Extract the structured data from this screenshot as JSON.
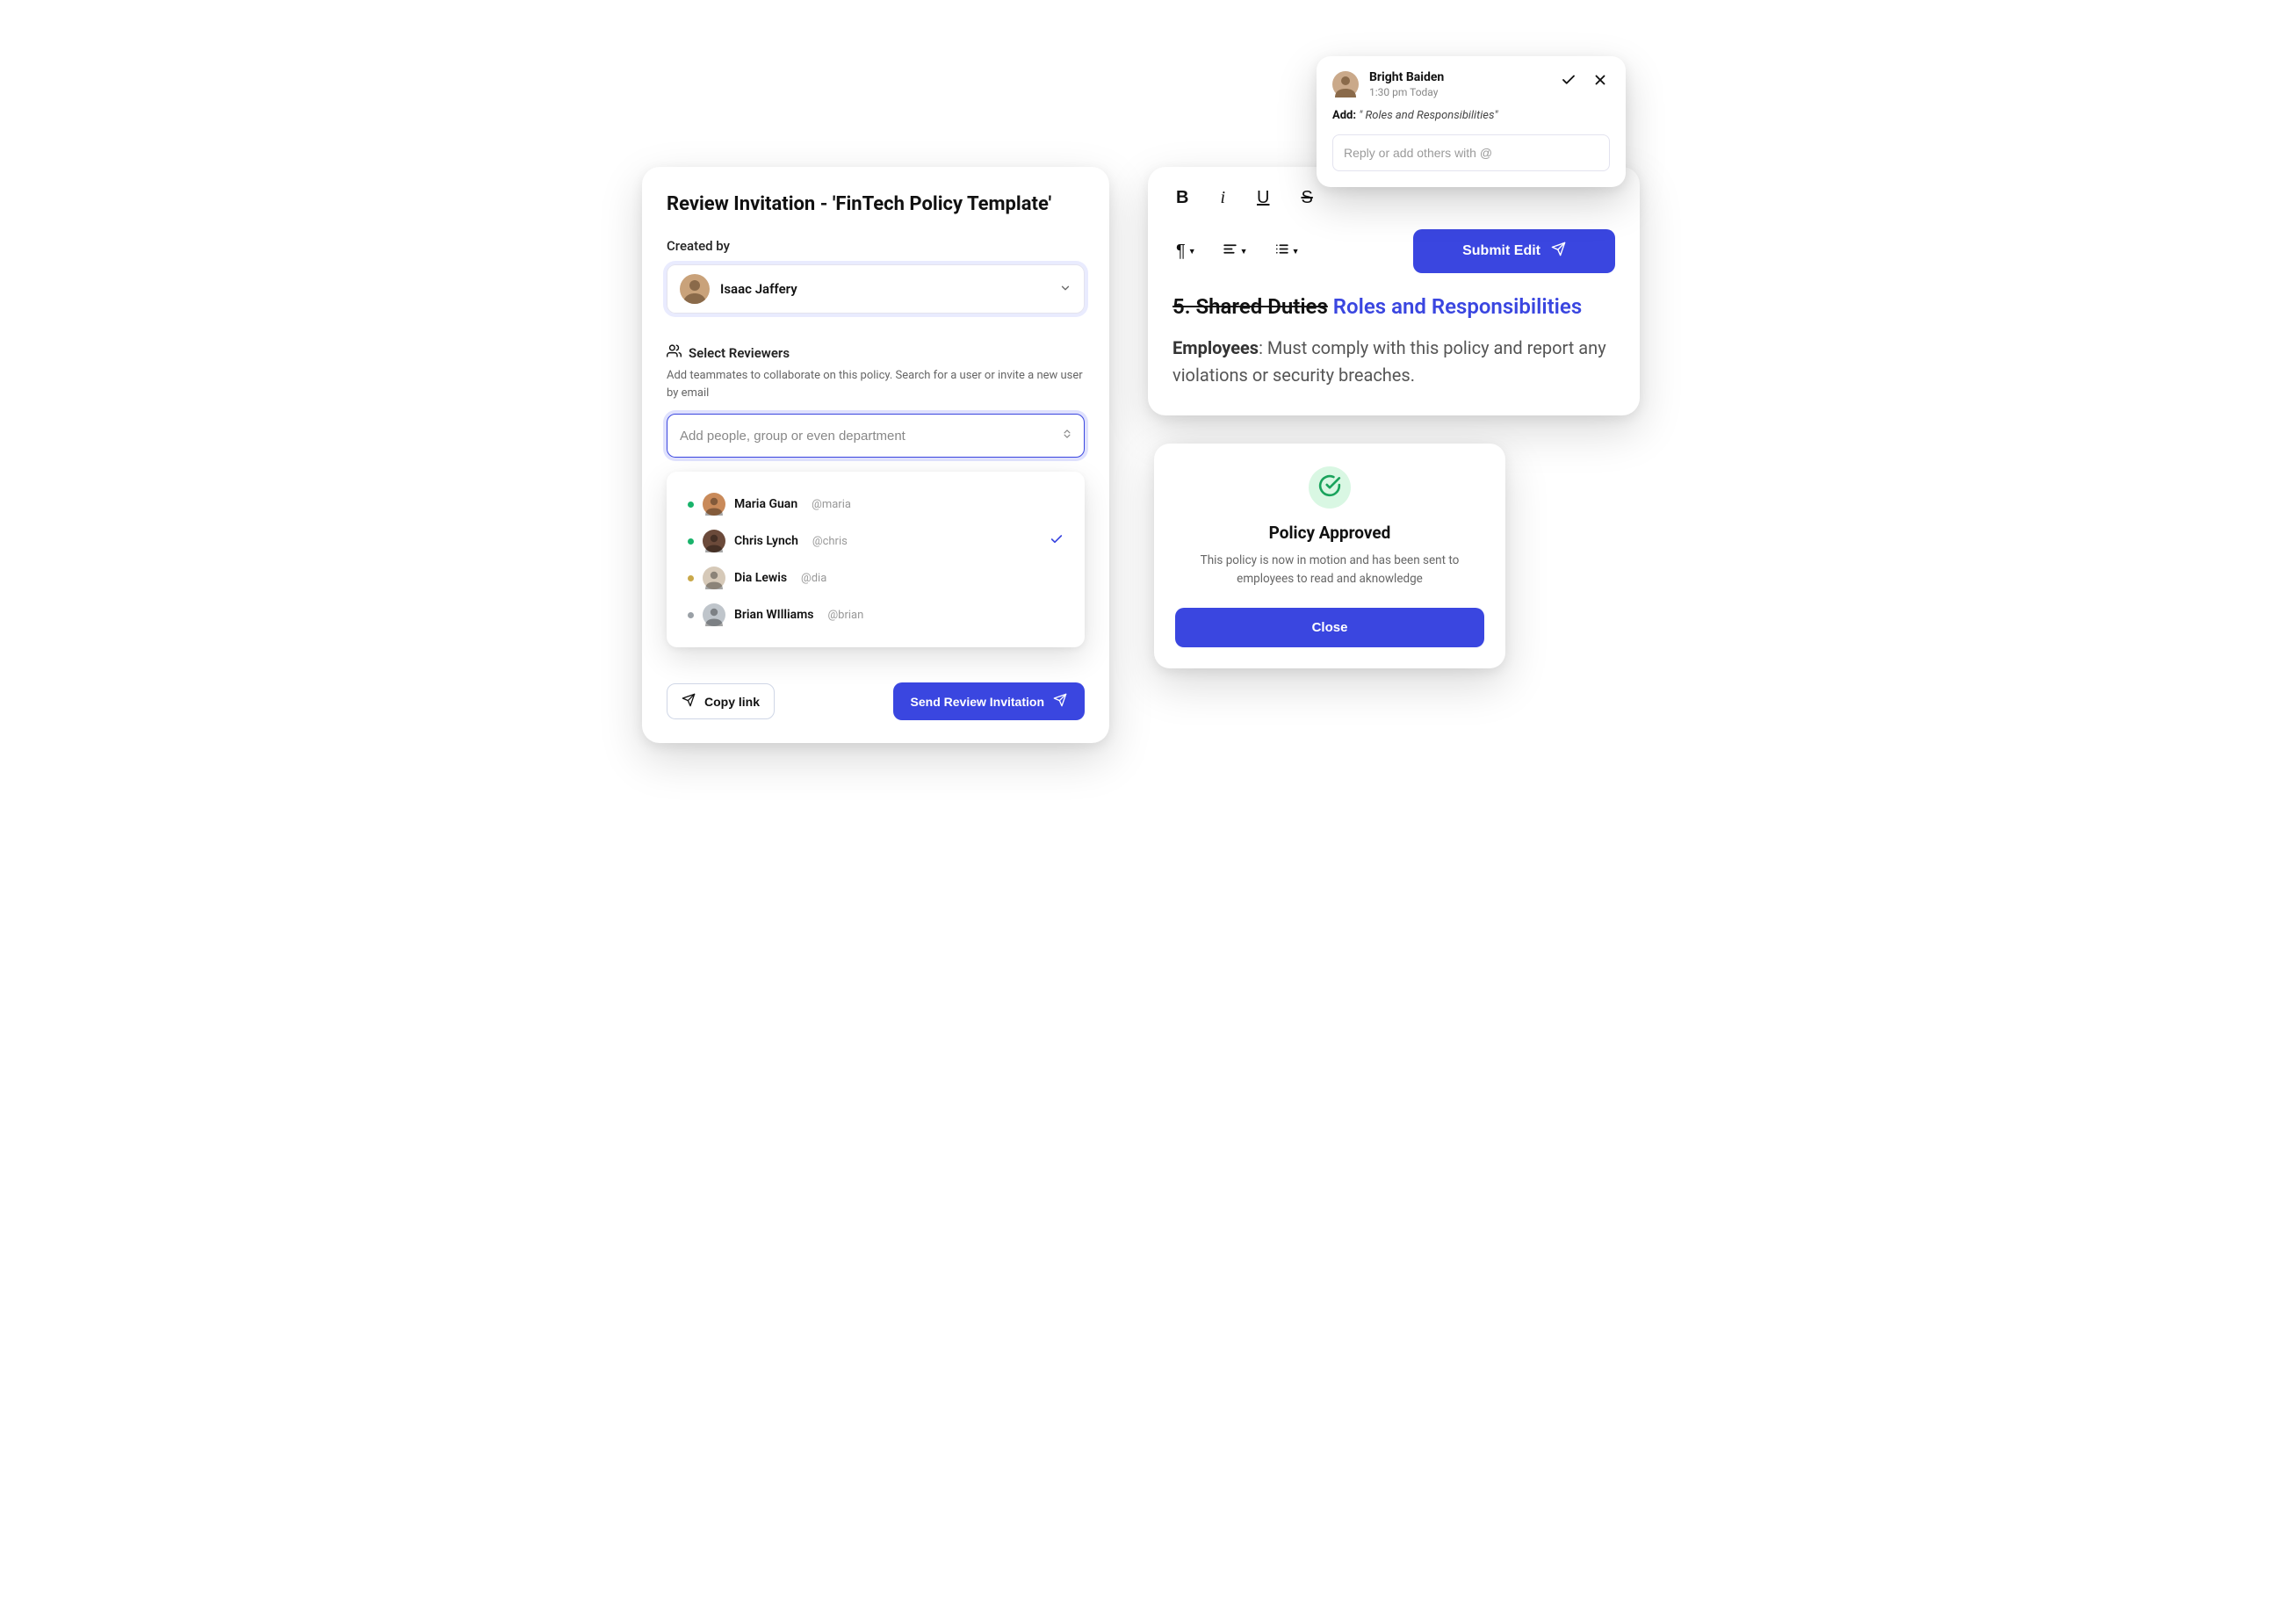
{
  "invite": {
    "title": "Review Invitation -  'FinTech Policy Template'",
    "created_by_label": "Created by",
    "created_by_name": "Isaac Jaffery",
    "reviewers_label": "Select Reviewers",
    "reviewers_help": "Add teammates to collaborate on this policy. Search for a user or invite a new user by email",
    "people_placeholder": "Add people, group or even department",
    "people": [
      {
        "name": "Maria Guan",
        "handle": "@maria",
        "status_color": "#19b36b",
        "avatar_bg": "#c98a5a",
        "selected": false
      },
      {
        "name": "Chris Lynch",
        "handle": "@chris",
        "status_color": "#19b36b",
        "avatar_bg": "#6b4a3a",
        "selected": true
      },
      {
        "name": "Dia Lewis",
        "handle": "@dia",
        "status_color": "#c9a84a",
        "avatar_bg": "#d6c9b8",
        "selected": false
      },
      {
        "name": "Brian WIlliams",
        "handle": "@brian",
        "status_color": "#9aa0a6",
        "avatar_bg": "#bfc5cb",
        "selected": false
      }
    ],
    "copy_link_label": "Copy link",
    "send_label": "Send Review Invitation"
  },
  "editor": {
    "submit_label": "Submit Edit",
    "line1_strike": "5. Shared Duties",
    "line1_insert": "Roles and Responsibilities",
    "line2_bold": "Employees",
    "line2_rest": ": Must comply with this policy and report any violations or security breaches."
  },
  "comment": {
    "user_name": "Bright Baiden",
    "time": "1:30 pm Today",
    "label": "Add:",
    "quote": "\" Roles and Responsibilities\"",
    "reply_placeholder": "Reply or add others with @"
  },
  "approved": {
    "title": "Policy Approved",
    "desc": "This policy is now in motion and has been sent to employees to read and aknowledge",
    "close_label": "Close"
  },
  "colors": {
    "primary": "#3a46e0",
    "success": "#1aa35c"
  }
}
